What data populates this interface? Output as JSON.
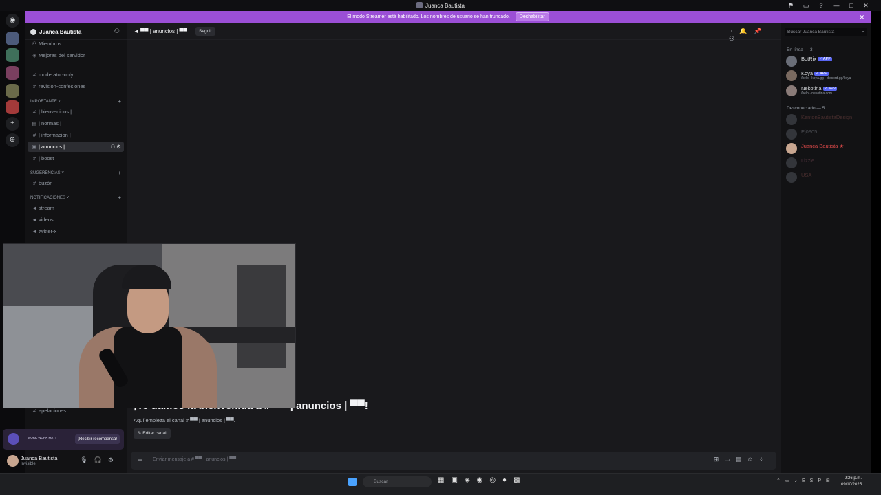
{
  "window": {
    "title": "Juanca Bautista",
    "controls": [
      "—",
      "□",
      "✕"
    ]
  },
  "banner": {
    "message": "El modo Streamer está habilitado. Los nombres de usuario se han truncado.",
    "button": "Deshabilitar"
  },
  "server": {
    "name": "Juanca Bautista",
    "channels": [
      {
        "label": "Miembros"
      },
      {
        "label": "Mejoras del servidor"
      },
      {
        "label": "moderator-only"
      },
      {
        "label": "revision-confesiones"
      },
      {
        "category": "IMPORTANTE"
      },
      {
        "label": "| bienvenidos |"
      },
      {
        "label": "| normas |"
      },
      {
        "label": "| informacion |"
      },
      {
        "label": "| anuncios |"
      },
      {
        "label": "| boost |"
      },
      {
        "category": "SUGERENCIAS"
      },
      {
        "label": "buzón"
      },
      {
        "category": "NOTIFICACIONES"
      },
      {
        "label": "stream"
      },
      {
        "label": "videos"
      },
      {
        "label": "twitter-x"
      },
      {
        "label": "apelaciones"
      }
    ]
  },
  "main": {
    "channel_name": "| anuncios |",
    "follow_label": "Seguir",
    "welcome_title": "¡Te damos la bienvenida a # ▀▀ | anuncios | ▀▀!",
    "welcome_subtitle": "Aquí empieza el canal # ▀▀ | anuncios | ▀▀.",
    "edit_channel": "Editar canal",
    "composer_placeholder": "Enviar mensaje a # ▀▀ | anuncios | ▀▀"
  },
  "members": {
    "search_placeholder": "Buscar Juanca Bautista",
    "online_header": "En línea — 3",
    "offline_header": "Desconectado — 5",
    "online": [
      {
        "name": "BotRix",
        "tag": "✓ APP",
        "sub": ""
      },
      {
        "name": "Koya",
        "tag": "✓ APP",
        "sub": "/help · koya.gg · discord.gg/koya"
      },
      {
        "name": "Nekotina",
        "tag": "✓ APP",
        "sub": "/help · nekotina.com"
      }
    ],
    "offline": [
      {
        "name": "KentonBautistaDesign"
      },
      {
        "name": "Ej0905"
      },
      {
        "name": "Juanca Bautista ★"
      },
      {
        "name": "Lizzie"
      },
      {
        "name": "USA"
      }
    ]
  },
  "user": {
    "name": "Juanca Bautista",
    "status": "Invisible",
    "promo_claim": "¡Recibir recompensa!",
    "promo_text": "WORK WORK MATT"
  },
  "taskbar": {
    "search": "Buscar",
    "time": "9:26 p.m.",
    "date": "09/10/2025"
  },
  "colors": {
    "banner": "#9b4fd6",
    "background": "#19191c",
    "sidebar": "#121214"
  }
}
